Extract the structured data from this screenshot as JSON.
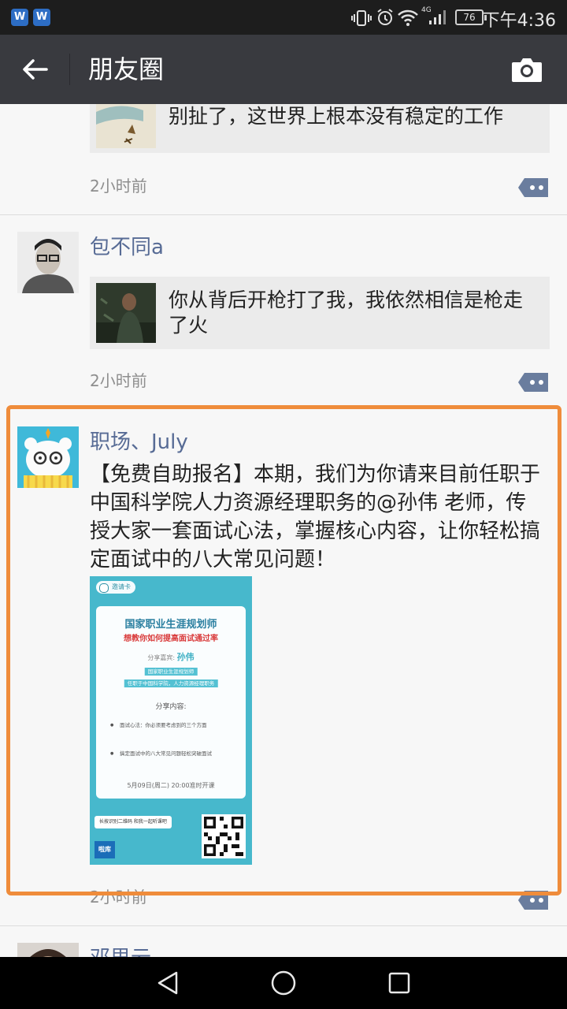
{
  "status_bar": {
    "app_icons": [
      "W",
      "W"
    ],
    "signal_label": "4G",
    "battery": "76",
    "time": "下午4:36"
  },
  "nav": {
    "back_icon": "arrow-left-icon",
    "title": "朋友圈",
    "camera_icon": "camera-icon"
  },
  "posts": [
    {
      "link_text": "别扯了，这世界上根本没有稳定的工作",
      "time": "2小时前"
    },
    {
      "nickname": "包不同a",
      "link_text": "你从背后开枪打了我，我依然相信是枪走了火",
      "time": "2小时前"
    },
    {
      "nickname": "职场、July",
      "text": "【免费自助报名】本期，我们为你请来目前任职于中国科学院人力资源经理职务的@孙伟 老师，传授大家一套面试心法，掌握核心内容，让你轻松搞定面试中的八大常见问题！",
      "poster": {
        "tag": "邀请卡",
        "title": "国家职业生涯规划师",
        "subtitle": "想教你如何提高面试通过率",
        "guest_label": "分享嘉宾:",
        "guest_name": "孙伟",
        "pill_1": "国家职业生涯规划师",
        "pill_2": "任职于中国科学院，人力资源经理职务",
        "content_heading": "分享内容:",
        "bullet_1": "面试心法：你必须要考虑到的三个方面",
        "bullet_2": "搞定面试中的八大常见问题轻松突破面试",
        "schedule": "5月09日(周二) 20:00准时开课",
        "footer": "长按识别二维码 和我一起听课吧",
        "logo": "啦库"
      },
      "time": "2小时前"
    },
    {
      "nickname": "邓思云"
    }
  ],
  "colors": {
    "nav_bg": "#393a3f",
    "nickname": "#576b95",
    "highlight": "#ef8c3b",
    "comment_button": "#6a7d9e"
  }
}
